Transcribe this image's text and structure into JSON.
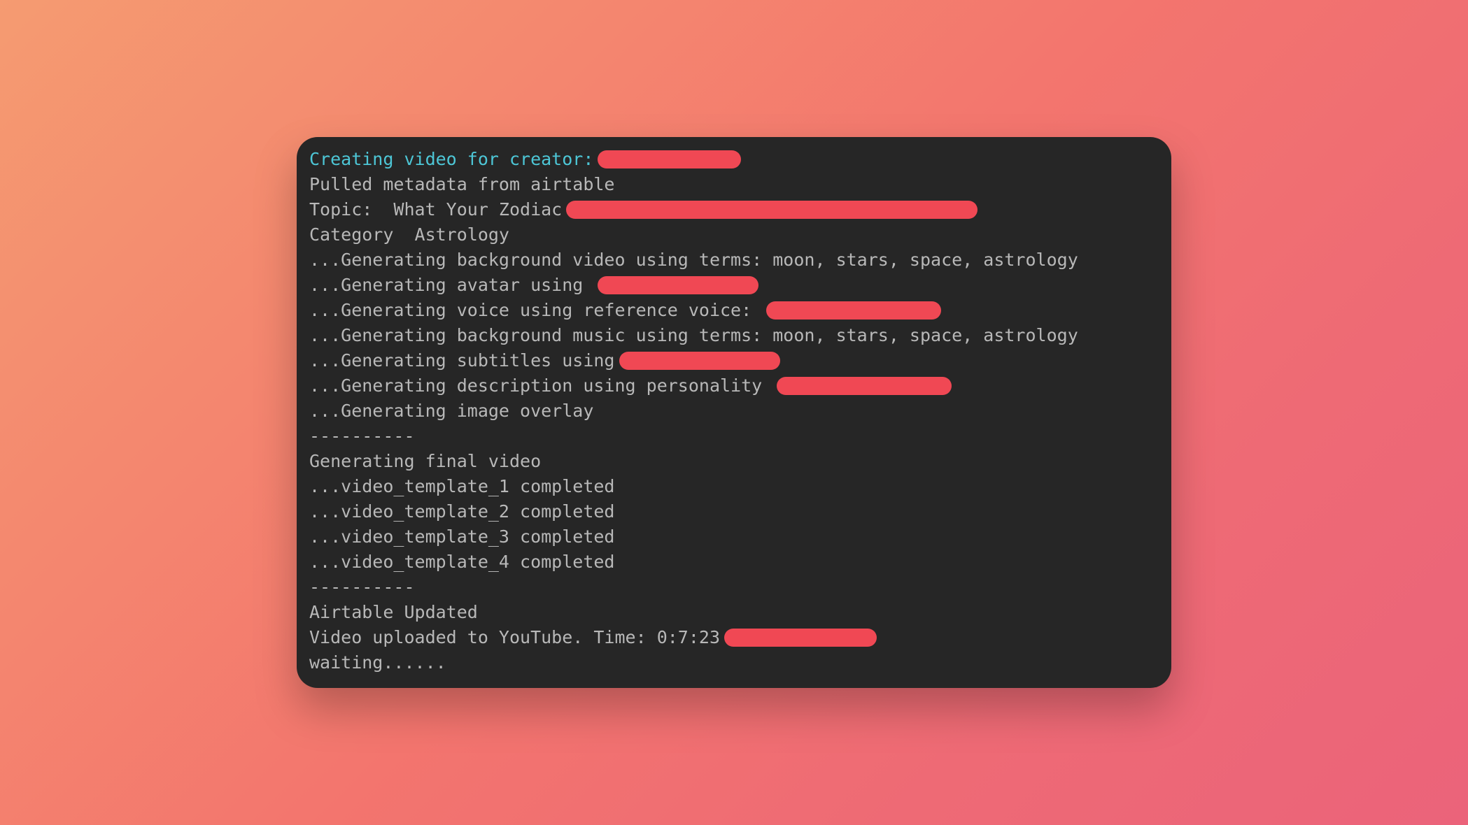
{
  "terminal": {
    "lines": [
      {
        "segments": [
          {
            "text": "Creating video for creator:",
            "class": "cyan"
          }
        ],
        "redaction_width": 205
      },
      {
        "segments": [
          {
            "text": "Pulled metadata from airtable",
            "class": "gray"
          }
        ]
      },
      {
        "segments": [
          {
            "text": "Topic:  What Your Zodiac",
            "class": "gray"
          }
        ],
        "redaction_width": 588
      },
      {
        "segments": [
          {
            "text": "Category  Astrology",
            "class": "gray"
          }
        ]
      },
      {
        "segments": [
          {
            "text": "...Generating background video using terms: moon, stars, space, astrology",
            "class": "gray"
          }
        ]
      },
      {
        "segments": [
          {
            "text": "...Generating avatar using ",
            "class": "gray"
          }
        ],
        "redaction_width": 230
      },
      {
        "segments": [
          {
            "text": "...Generating voice using reference voice: ",
            "class": "gray"
          }
        ],
        "redaction_width": 250
      },
      {
        "segments": [
          {
            "text": "...Generating background music using terms: moon, stars, space, astrology",
            "class": "gray"
          }
        ]
      },
      {
        "segments": [
          {
            "text": "...Generating subtitles using",
            "class": "gray"
          }
        ],
        "redaction_width": 230
      },
      {
        "segments": [
          {
            "text": "...Generating description using personality ",
            "class": "gray"
          }
        ],
        "redaction_width": 250
      },
      {
        "segments": [
          {
            "text": "...Generating image overlay",
            "class": "gray"
          }
        ]
      },
      {
        "segments": [
          {
            "text": "----------",
            "class": "gray"
          }
        ]
      },
      {
        "segments": [
          {
            "text": "Generating final video",
            "class": "gray"
          }
        ]
      },
      {
        "segments": [
          {
            "text": "...video_template_1 completed",
            "class": "gray"
          }
        ]
      },
      {
        "segments": [
          {
            "text": "...video_template_2 completed",
            "class": "gray"
          }
        ]
      },
      {
        "segments": [
          {
            "text": "...video_template_3 completed",
            "class": "gray"
          }
        ]
      },
      {
        "segments": [
          {
            "text": "...video_template_4 completed",
            "class": "gray"
          }
        ]
      },
      {
        "segments": [
          {
            "text": "----------",
            "class": "gray"
          }
        ]
      },
      {
        "segments": [
          {
            "text": "Airtable Updated",
            "class": "gray"
          }
        ]
      },
      {
        "segments": [
          {
            "text": "Video uploaded to YouTube. Time: 0:7:23",
            "class": "gray"
          }
        ],
        "redaction_width": 218
      },
      {
        "segments": [
          {
            "text": "waiting......",
            "class": "gray"
          }
        ]
      }
    ]
  }
}
